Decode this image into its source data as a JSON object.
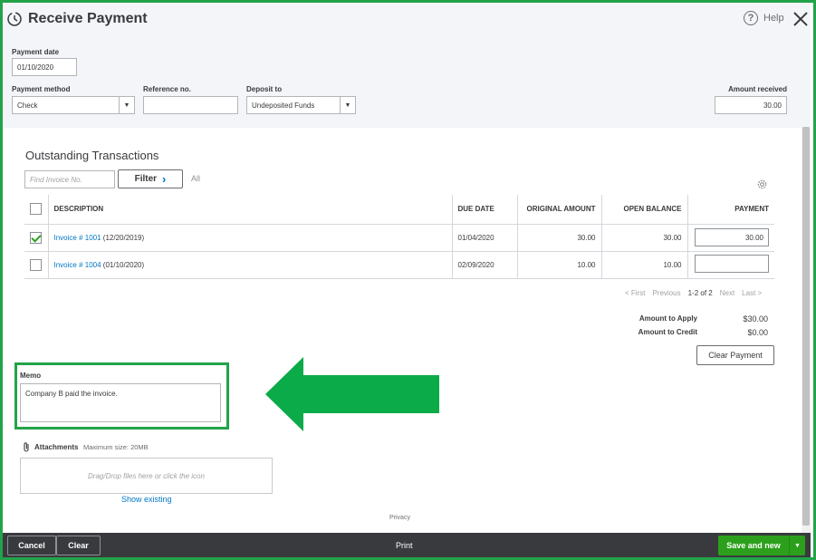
{
  "window": {
    "title": "Receive Payment",
    "help_label": "Help",
    "help_glyph": "?"
  },
  "form": {
    "payment_date_label": "Payment date",
    "payment_date_value": "01/10/2020",
    "payment_method_label": "Payment method",
    "payment_method_value": "Check",
    "reference_label": "Reference no.",
    "reference_value": "",
    "deposit_label": "Deposit to",
    "deposit_value": "Undeposited Funds",
    "amount_received_label": "Amount received",
    "amount_received_value": "30.00"
  },
  "outstanding": {
    "title": "Outstanding Transactions",
    "find_placeholder": "Find Invoice No.",
    "filter_label": "Filter",
    "filter_chevron": "›",
    "all_label": "All",
    "columns": {
      "description": "DESCRIPTION",
      "due_date": "DUE DATE",
      "original_amount": "ORIGINAL AMOUNT",
      "open_balance": "OPEN BALANCE",
      "payment": "PAYMENT"
    },
    "rows": [
      {
        "checked": true,
        "invoice_link": "Invoice # 1001",
        "invoice_date": "(12/20/2019)",
        "due_date": "01/04/2020",
        "original_amount": "30.00",
        "open_balance": "30.00",
        "payment": "30.00"
      },
      {
        "checked": false,
        "invoice_link": "Invoice # 1004",
        "invoice_date": "(01/10/2020)",
        "due_date": "02/09/2020",
        "original_amount": "10.00",
        "open_balance": "10.00",
        "payment": ""
      }
    ],
    "pager": {
      "first": "< First",
      "previous": "Previous",
      "range": "1-2 of 2",
      "next": "Next",
      "last": "Last >"
    }
  },
  "totals": {
    "amount_to_apply_label": "Amount to Apply",
    "amount_to_apply_value": "$30.00",
    "amount_to_credit_label": "Amount to Credit",
    "amount_to_credit_value": "$0.00",
    "clear_payment_label": "Clear Payment"
  },
  "memo": {
    "label": "Memo",
    "value": "Company B paid the invoice."
  },
  "attachments": {
    "label": "Attachments",
    "max_size": "Maximum size: 20MB",
    "drop_text": "Drag/Drop files here or click the icon",
    "show_existing": "Show existing"
  },
  "privacy": "Privacy",
  "footer": {
    "cancel": "Cancel",
    "clear": "Clear",
    "print": "Print",
    "save_and_new": "Save and new",
    "save_dropdown_glyph": "▼"
  },
  "colors": {
    "highlight_green": "#22a34a",
    "brand_green": "#2ca01c",
    "link_blue": "#0077c5",
    "footer_dark": "#393a3d"
  },
  "icons": {
    "title": "history-clock-icon",
    "help": "help-circle-icon",
    "close": "close-icon",
    "settings": "gear-icon",
    "attachment": "paperclip-icon",
    "annotation": "arrow-left-icon"
  }
}
